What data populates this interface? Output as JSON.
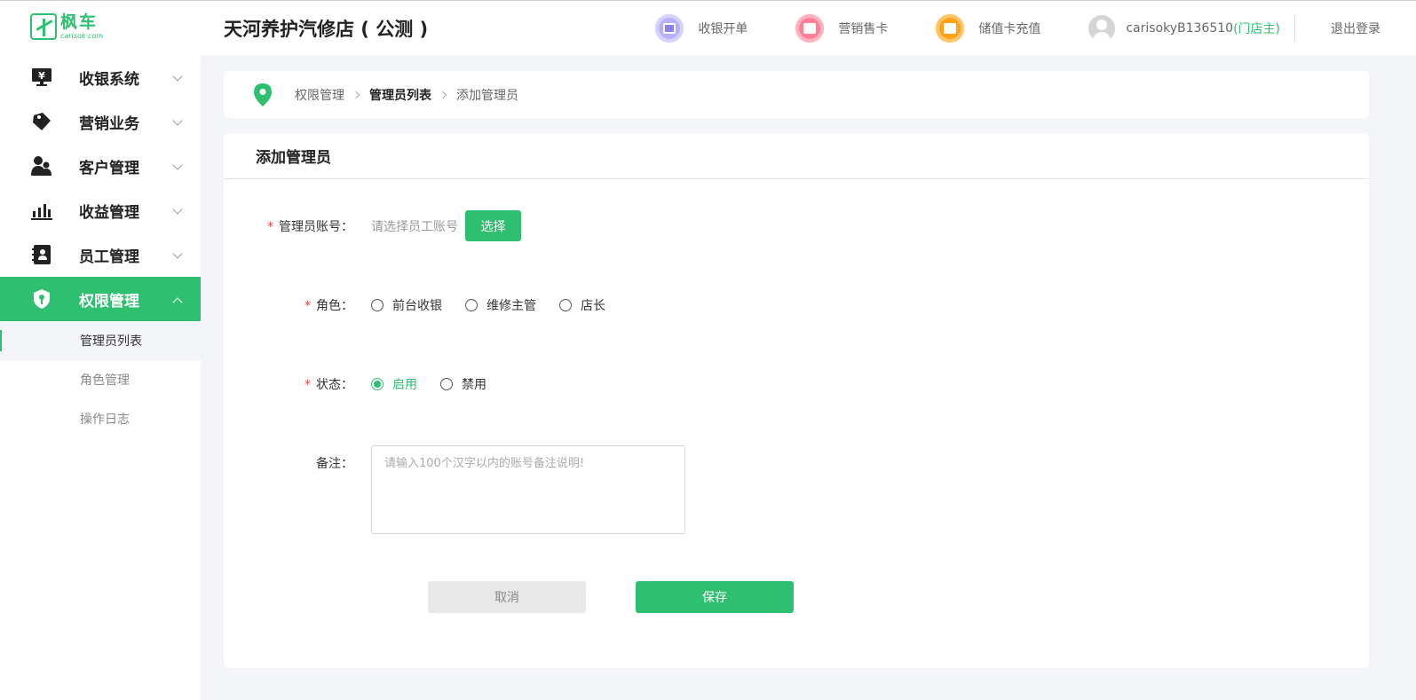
{
  "brand": {
    "name_cn": "枫车",
    "name_en": "carisok·com",
    "color": "#2fbf71"
  },
  "header": {
    "store_title": "天河养护汽修店 ( 公测 )",
    "actions": [
      {
        "label": "收银开单",
        "icon": "cashier-order-icon",
        "color": "#b9b1f6"
      },
      {
        "label": "营销售卡",
        "icon": "sell-card-icon",
        "color": "#ff7f96"
      },
      {
        "label": "储值卡充值",
        "icon": "recharge-card-icon",
        "color": "#ffa21a"
      }
    ],
    "user_name": "carisokyB136510",
    "user_role": "(门店主)",
    "logout_label": "退出登录"
  },
  "sidebar": {
    "items": [
      {
        "label": "收银系统",
        "icon": "cashier-monitor-icon"
      },
      {
        "label": "营销业务",
        "icon": "tag-icon"
      },
      {
        "label": "客户管理",
        "icon": "customers-icon"
      },
      {
        "label": "收益管理",
        "icon": "bar-chart-icon"
      },
      {
        "label": "员工管理",
        "icon": "staff-book-icon"
      },
      {
        "label": "权限管理",
        "icon": "shield-key-icon",
        "active": true
      }
    ],
    "sub_items": [
      {
        "label": "管理员列表",
        "active": true
      },
      {
        "label": "角色管理"
      },
      {
        "label": "操作日志"
      }
    ]
  },
  "breadcrumb": [
    "权限管理",
    "管理员列表",
    "添加管理员"
  ],
  "form": {
    "title": "添加管理员",
    "account_label": "管理员账号：",
    "account_placeholder": "请选择员工账号",
    "choose_label": "选择",
    "role_label": "角色：",
    "roles": [
      "前台收银",
      "维修主管",
      "店长"
    ],
    "status_label": "状态：",
    "statuses": [
      "启用",
      "禁用"
    ],
    "status_selected": "启用",
    "remark_label": "备注：",
    "remark_placeholder": "请输入100个汉字以内的账号备注说明!",
    "cancel_label": "取消",
    "save_label": "保存"
  }
}
